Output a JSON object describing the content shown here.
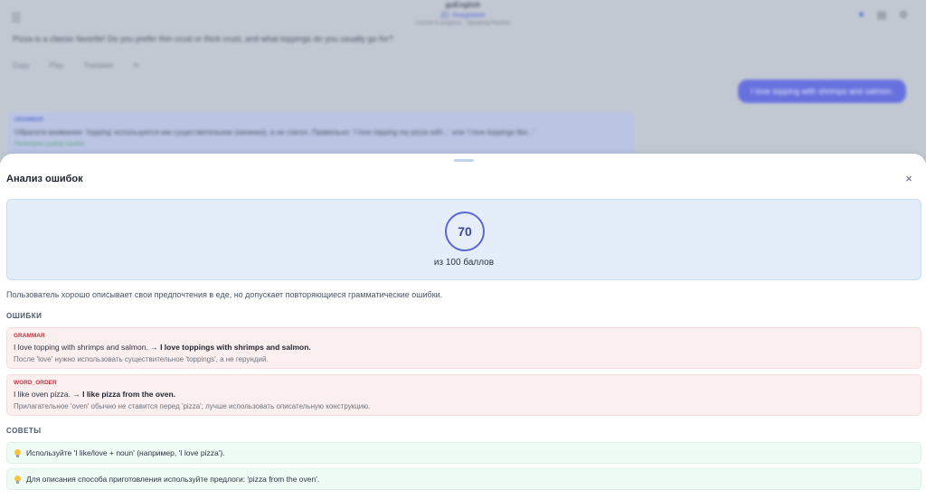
{
  "background": {
    "app_title": "guEnglish",
    "subtitle": "Д1 Академия",
    "note": "Lesson in progress · Speaking Practice",
    "ai_message": "Pizza is a classic favorite! Do you prefer thin crust or thick crust, and what toppings do you usually go for?",
    "actions": [
      "Copy",
      "Play",
      "Translate",
      "↻"
    ],
    "user_message": "I love topping with shrimps and salmon.",
    "fix_card": {
      "label": "GRAMMAR",
      "text": "Обратите внимание: 'topping' используется как существительное (начинка), а не глагол. Правильно: 'I love topping my pizza with...' или 'I love toppings like...'",
      "link": "Посмотреть разбор ошибок"
    }
  },
  "sheet": {
    "title": "Анализ ошибок",
    "close_label": "×",
    "score": {
      "value": "70",
      "caption": "из 100 баллов"
    },
    "summary": "Пользователь хорошо описывает свои предпочтения в еде, но допускает повторяющиеся грамматические ошибки.",
    "errors_label": "ОШИБКИ",
    "errors": [
      {
        "type": "GRAMMAR",
        "original": "I love topping with shrimps and salmon.",
        "arrow": "→",
        "corrected": "I love toppings with shrimps and salmon.",
        "explanation": "После 'love' нужно использовать существительное 'toppings', а не герундий."
      },
      {
        "type": "WORD_ORDER",
        "original": "I like oven pizza.",
        "arrow": "→",
        "corrected": "I like pizza from the oven.",
        "explanation": "Прилагательное 'oven' обычно не ставится перед 'pizza'; лучше использовать описательную конструкцию."
      }
    ],
    "tips_label": "СОВЕТЫ",
    "tips": [
      "Используйте 'I like/love + noun' (например, 'I love pizza').",
      "Для описания способа приготовления используйте предлоги: 'pizza from the oven'."
    ]
  },
  "colors": {
    "accent": "#5b66d6",
    "error_bg": "#fcefef",
    "error_type": "#c2343f",
    "tip_bg": "#effbf5",
    "score_bg": "#e3eefa"
  }
}
